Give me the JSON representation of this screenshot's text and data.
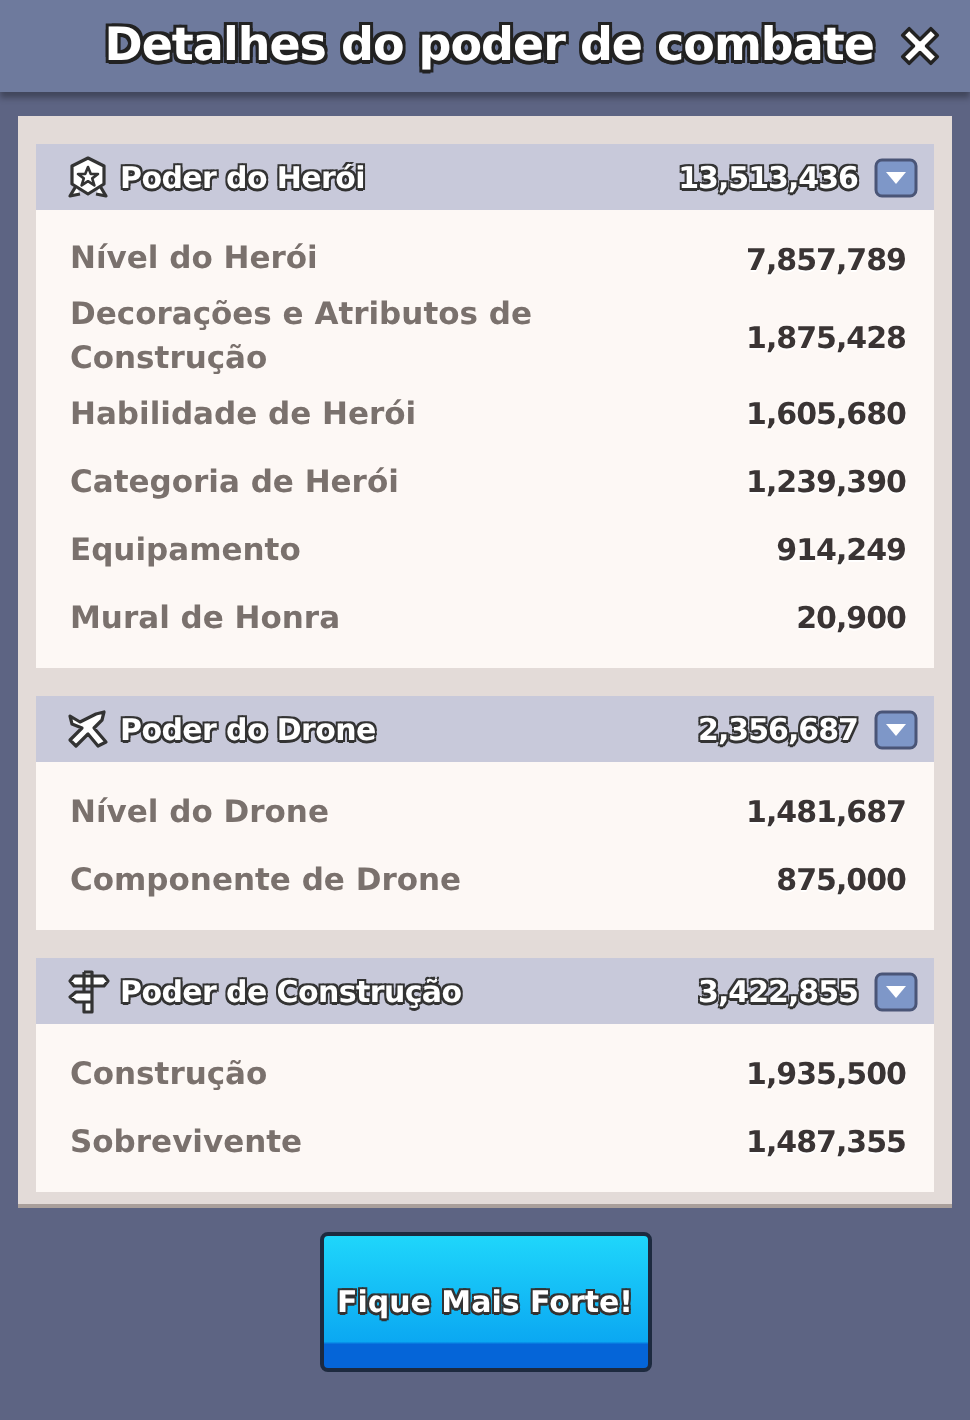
{
  "window": {
    "title": "Detalhes do poder de combate"
  },
  "sections": [
    {
      "kind": "hero",
      "title": "Poder do Herói",
      "total": "13,513,436",
      "rows": [
        {
          "label": "Nível do Herói",
          "value": "7,857,789"
        },
        {
          "label": "Decorações e Atributos de Construção",
          "value": "1,875,428"
        },
        {
          "label": "Habilidade de Herói",
          "value": "1,605,680"
        },
        {
          "label": "Categoria de Herói",
          "value": "1,239,390"
        },
        {
          "label": "Equipamento",
          "value": "914,249"
        },
        {
          "label": "Mural de Honra",
          "value": "20,900"
        }
      ]
    },
    {
      "kind": "drone",
      "title": "Poder do Drone",
      "total": "2,356,687",
      "rows": [
        {
          "label": "Nível do Drone",
          "value": "1,481,687"
        },
        {
          "label": "Componente de Drone",
          "value": "875,000"
        }
      ]
    },
    {
      "kind": "building",
      "title": "Poder de Construção",
      "total": "3,422,855",
      "rows": [
        {
          "label": "Construção",
          "value": "1,935,500"
        },
        {
          "label": "Sobrevivente",
          "value": "1,487,355"
        }
      ]
    }
  ],
  "button": "Fique Mais Forte!"
}
